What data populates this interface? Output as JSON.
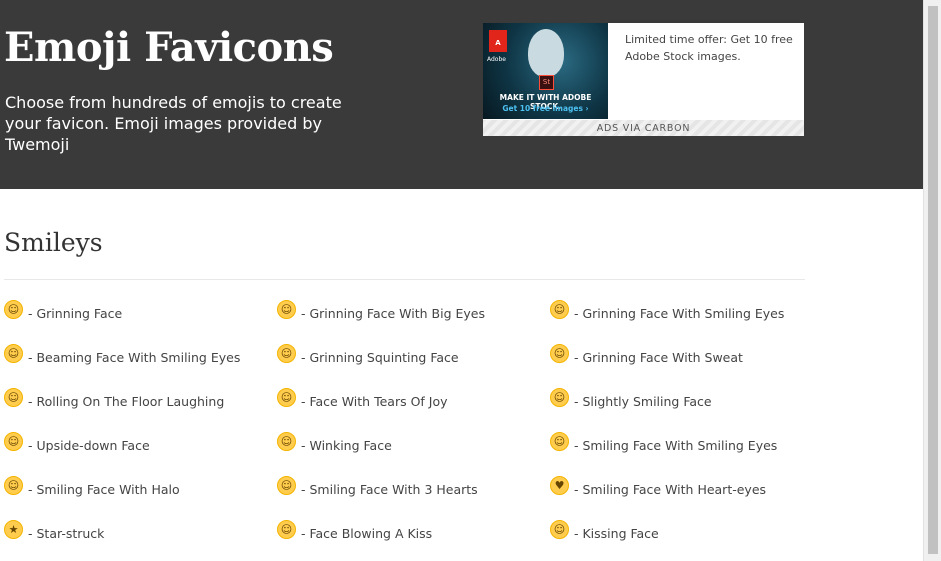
{
  "hero": {
    "title": "Emoji Favicons",
    "subtitle": "Choose from hundreds of emojis to create your favicon. Emoji images provided by Twemoji"
  },
  "ad": {
    "logo": "Adobe",
    "badge": "St",
    "line1": "MAKE IT WITH ADOBE STOCK.",
    "line2": "Get 10 free images ›",
    "text": "Limited time offer: Get 10 free Adobe Stock images.",
    "footer": "ADS VIA CARBON"
  },
  "section": {
    "title": "Smileys"
  },
  "emojis": [
    {
      "label": "- Grinning Face",
      "glyph": "☺"
    },
    {
      "label": "- Grinning Face With Big Eyes",
      "glyph": "☺"
    },
    {
      "label": "- Grinning Face With Smiling Eyes",
      "glyph": "☺"
    },
    {
      "label": "- Beaming Face With Smiling Eyes",
      "glyph": "☺"
    },
    {
      "label": "- Grinning Squinting Face",
      "glyph": "☺"
    },
    {
      "label": "- Grinning Face With Sweat",
      "glyph": "☺"
    },
    {
      "label": "- Rolling On The Floor Laughing",
      "glyph": "☺"
    },
    {
      "label": "- Face With Tears Of Joy",
      "glyph": "☺"
    },
    {
      "label": "- Slightly Smiling Face",
      "glyph": "☺"
    },
    {
      "label": "- Upside-down Face",
      "glyph": "☺"
    },
    {
      "label": "- Winking Face",
      "glyph": "☺"
    },
    {
      "label": "- Smiling Face With Smiling Eyes",
      "glyph": "☺"
    },
    {
      "label": "- Smiling Face With Halo",
      "glyph": "☺"
    },
    {
      "label": "- Smiling Face With 3 Hearts",
      "glyph": "☺"
    },
    {
      "label": "- Smiling Face With Heart-eyes",
      "glyph": "♥"
    },
    {
      "label": "- Star-struck",
      "glyph": "★"
    },
    {
      "label": "- Face Blowing A Kiss",
      "glyph": "☺"
    },
    {
      "label": "- Kissing Face",
      "glyph": "☺"
    }
  ]
}
